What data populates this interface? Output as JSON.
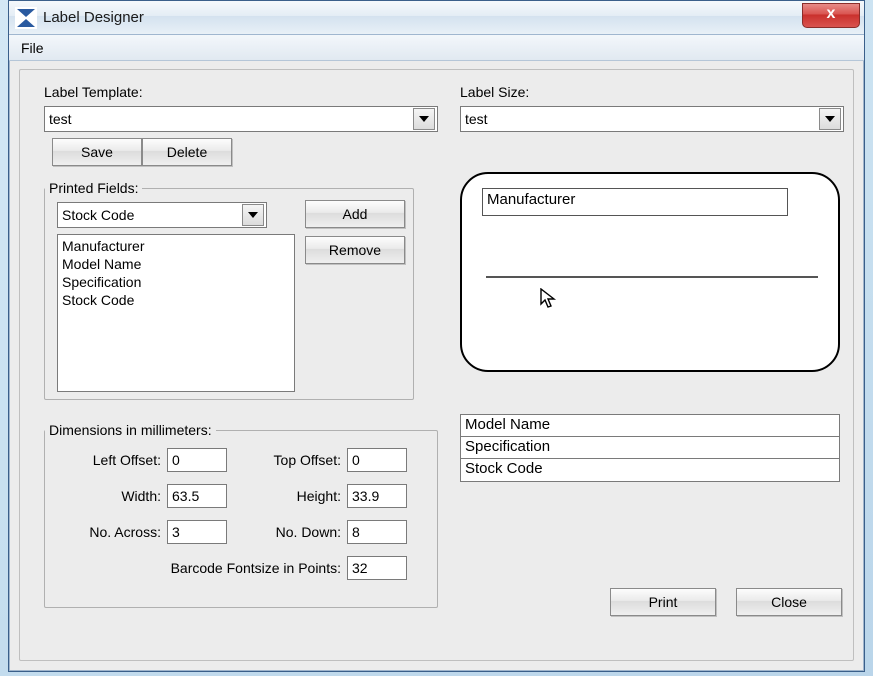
{
  "title": "Label Designer",
  "menu": {
    "file": "File"
  },
  "labelTemplate": {
    "label": "Label Template:",
    "value": "test"
  },
  "labelSize": {
    "label": "Label Size:",
    "value": "test"
  },
  "buttons": {
    "save": "Save",
    "delete": "Delete",
    "add": "Add",
    "remove": "Remove",
    "print": "Print",
    "close": "Close"
  },
  "printedFields": {
    "legend": "Printed Fields:",
    "selector": "Stock Code",
    "items": [
      "Manufacturer",
      "Model Name",
      "Specification",
      "Stock Code"
    ]
  },
  "dimensions": {
    "legend": "Dimensions in millimeters:",
    "leftOffsetLabel": "Left Offset:",
    "leftOffset": "0",
    "topOffsetLabel": "Top Offset:",
    "topOffset": "0",
    "widthLabel": "Width:",
    "width": "63.5",
    "heightLabel": "Height:",
    "height": "33.9",
    "noAcrossLabel": "No. Across:",
    "noAcross": "3",
    "noDownLabel": "No. Down:",
    "noDown": "8",
    "barcodeLabel": "Barcode Fontsize in Points:",
    "barcode": "32"
  },
  "preview": {
    "field": "Manufacturer"
  },
  "gridItems": [
    "Model Name",
    "Specification",
    "Stock Code"
  ]
}
